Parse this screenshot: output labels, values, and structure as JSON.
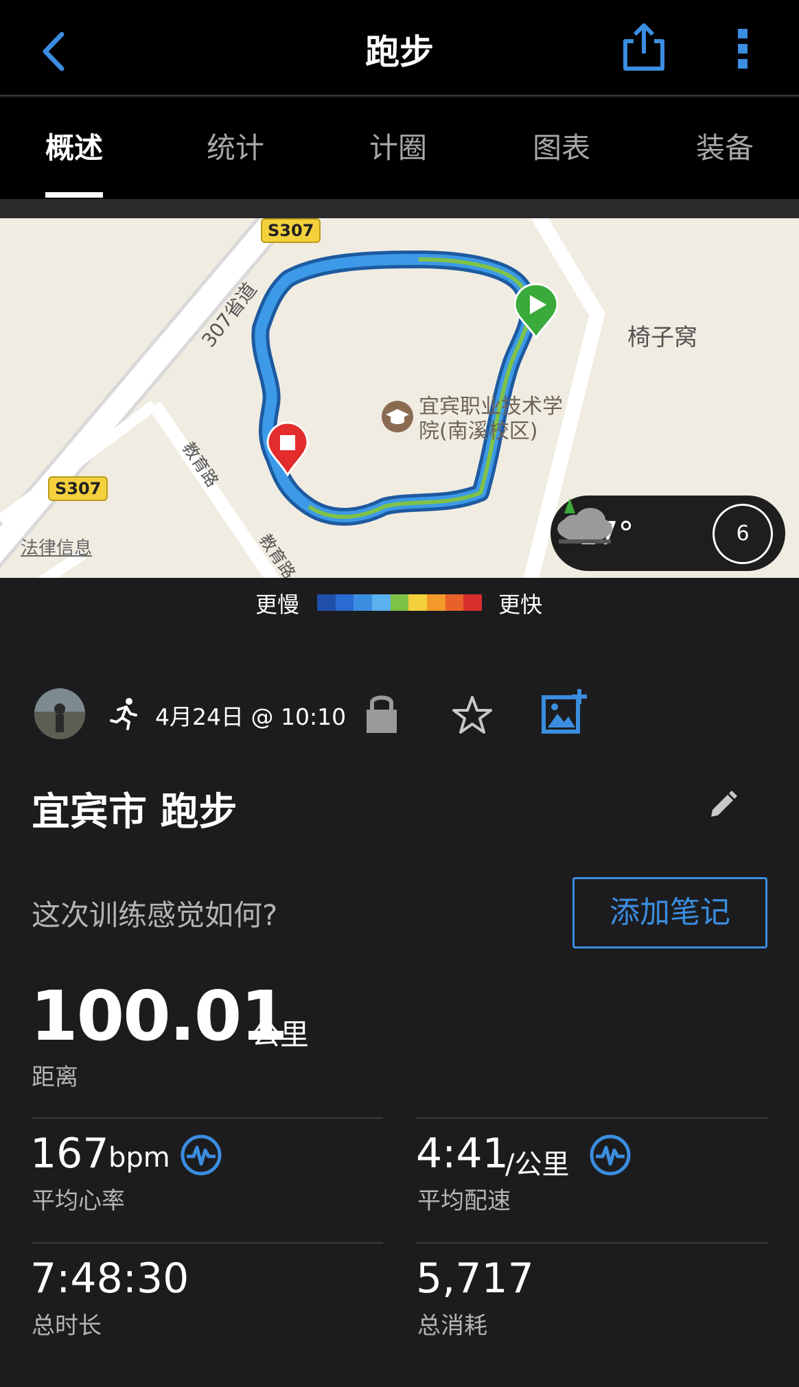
{
  "header": {
    "title": "跑步",
    "back_icon": "chevron-left-icon",
    "share_icon": "share-icon",
    "more_icon": "more-vertical-icon",
    "accent_color": "#3b8de0"
  },
  "tabs": [
    {
      "label": "概述",
      "active": true
    },
    {
      "label": "统计",
      "active": false
    },
    {
      "label": "计圈",
      "active": false
    },
    {
      "label": "图表",
      "active": false
    },
    {
      "label": "装备",
      "active": false
    }
  ],
  "map": {
    "place_label": "椅子窝",
    "poi_line1": "宜宾职业技术学",
    "poi_line2": "院(南溪校区)",
    "road_badge_1": "S307",
    "road_badge_2": "S307",
    "road_label_1": "307省道",
    "road_label_2": "教育路",
    "road_label_3": "教育路",
    "legal_text": "法律信息",
    "start_marker_icon": "start-flag-icon",
    "end_marker_icon": "finish-flag-icon"
  },
  "weather": {
    "temperature": "17°",
    "condition_icon": "cloudy-icon",
    "wind_speed": "6"
  },
  "pace_legend": {
    "slower_label": "更慢",
    "faster_label": "更快",
    "colors": [
      "#1f4fa8",
      "#2a6bd1",
      "#3b8de0",
      "#5bb0f0",
      "#7ec24a",
      "#f4d13c",
      "#f49a2a",
      "#e8602a",
      "#d92e2e"
    ]
  },
  "activity": {
    "avatar_icon": "avatar",
    "type_icon": "running-icon",
    "date_time": "4月24日 @ 10:10",
    "privacy_icon": "lock-icon",
    "favorite_icon": "star-icon",
    "add_photo_icon": "add-photo-icon",
    "name": "宜宾市 跑步",
    "edit_icon": "pencil-icon",
    "feeling_question": "这次训练感觉如何?",
    "add_note_label": "添加笔记"
  },
  "summary": {
    "distance_value": "100.01",
    "distance_unit": "公里",
    "distance_label": "距离"
  },
  "stats": {
    "heart_rate_value": "167",
    "heart_rate_unit": "bpm",
    "heart_rate_label": "平均心率",
    "pace_value": "4:41",
    "pace_unit": "/公里",
    "pace_label": "平均配速",
    "duration_value": "7:48:30",
    "duration_label": "总时长",
    "calories_value": "5,717",
    "calories_label": "总消耗"
  }
}
